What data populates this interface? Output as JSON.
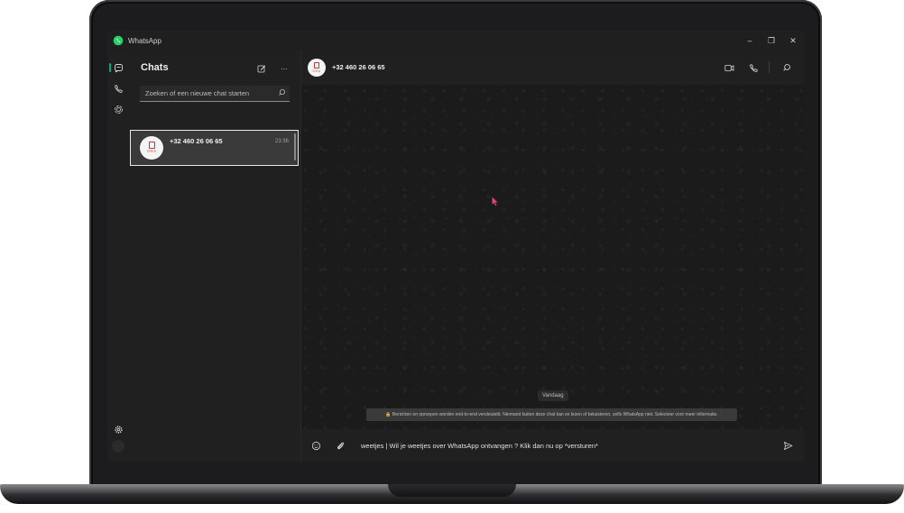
{
  "window": {
    "app_title": "WhatsApp",
    "controls": {
      "minimize": "–",
      "maximize": "❐",
      "close": "✕"
    }
  },
  "rail": {
    "items": [
      {
        "name": "chats",
        "icon": "chat-bubble-icon",
        "active": true
      },
      {
        "name": "calls",
        "icon": "phone-icon",
        "active": false
      },
      {
        "name": "status",
        "icon": "status-ring-icon",
        "active": false
      }
    ],
    "settings_icon": "gear-icon"
  },
  "chatlist": {
    "title": "Chats",
    "new_chat_icon": "compose-icon",
    "menu_label": "···",
    "search": {
      "placeholder": "Zoeken of een nieuwe chat starten",
      "icon": "search-icon"
    },
    "items": [
      {
        "name": "+32 460 26 06 65",
        "time": "23:36",
        "selected": true
      }
    ]
  },
  "conversation": {
    "contact_name": "+32 460 26 06 65",
    "header_icons": [
      "video-call-icon",
      "voice-call-icon",
      "search-icon"
    ],
    "date_divider": "Vandaag",
    "system_message": "🔒 Berichten en oproepen worden end-to-end versleuteld. Niemand buiten deze chat kan ze lezen of beluisteren, zelfs WhatsApp niet. Selecteer voor meer informatie.",
    "composer": {
      "emoji_icon": "emoji-icon",
      "attach_icon": "paperclip-icon",
      "draft_text": "weetjes | Wil je weetjes over WhatsApp ontvangen ? Klik dan nu op *versturen*",
      "send_icon": "send-icon"
    }
  },
  "colors": {
    "accent": "#00a884",
    "background": "#202020",
    "panel": "#1e1e1e",
    "selected_item": "#3a3a3a",
    "cursor": "#e0486b"
  }
}
